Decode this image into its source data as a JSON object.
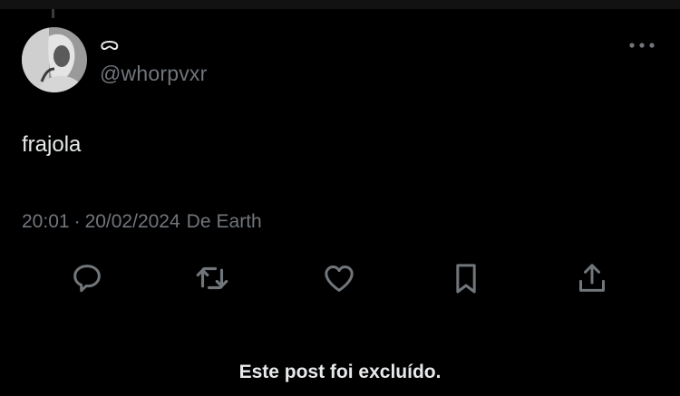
{
  "post": {
    "display_name": "ᯅ",
    "handle": "@whorpvxr",
    "text": "frajola",
    "time": "20:01",
    "separator": "·",
    "date": "20/02/2024",
    "source_label": "De",
    "source": "Earth"
  },
  "actions": {
    "reply_icon": "speech-bubble",
    "repost_icon": "two-arrows-loop",
    "like_icon": "heart-outline",
    "bookmark_icon": "bookmark-outline",
    "share_icon": "upload-arrow"
  },
  "notice": {
    "deleted_text": "Este post foi excluído."
  },
  "colors": {
    "background": "#000000",
    "primary_text": "#e7e9ea",
    "secondary_text": "#71767b"
  }
}
